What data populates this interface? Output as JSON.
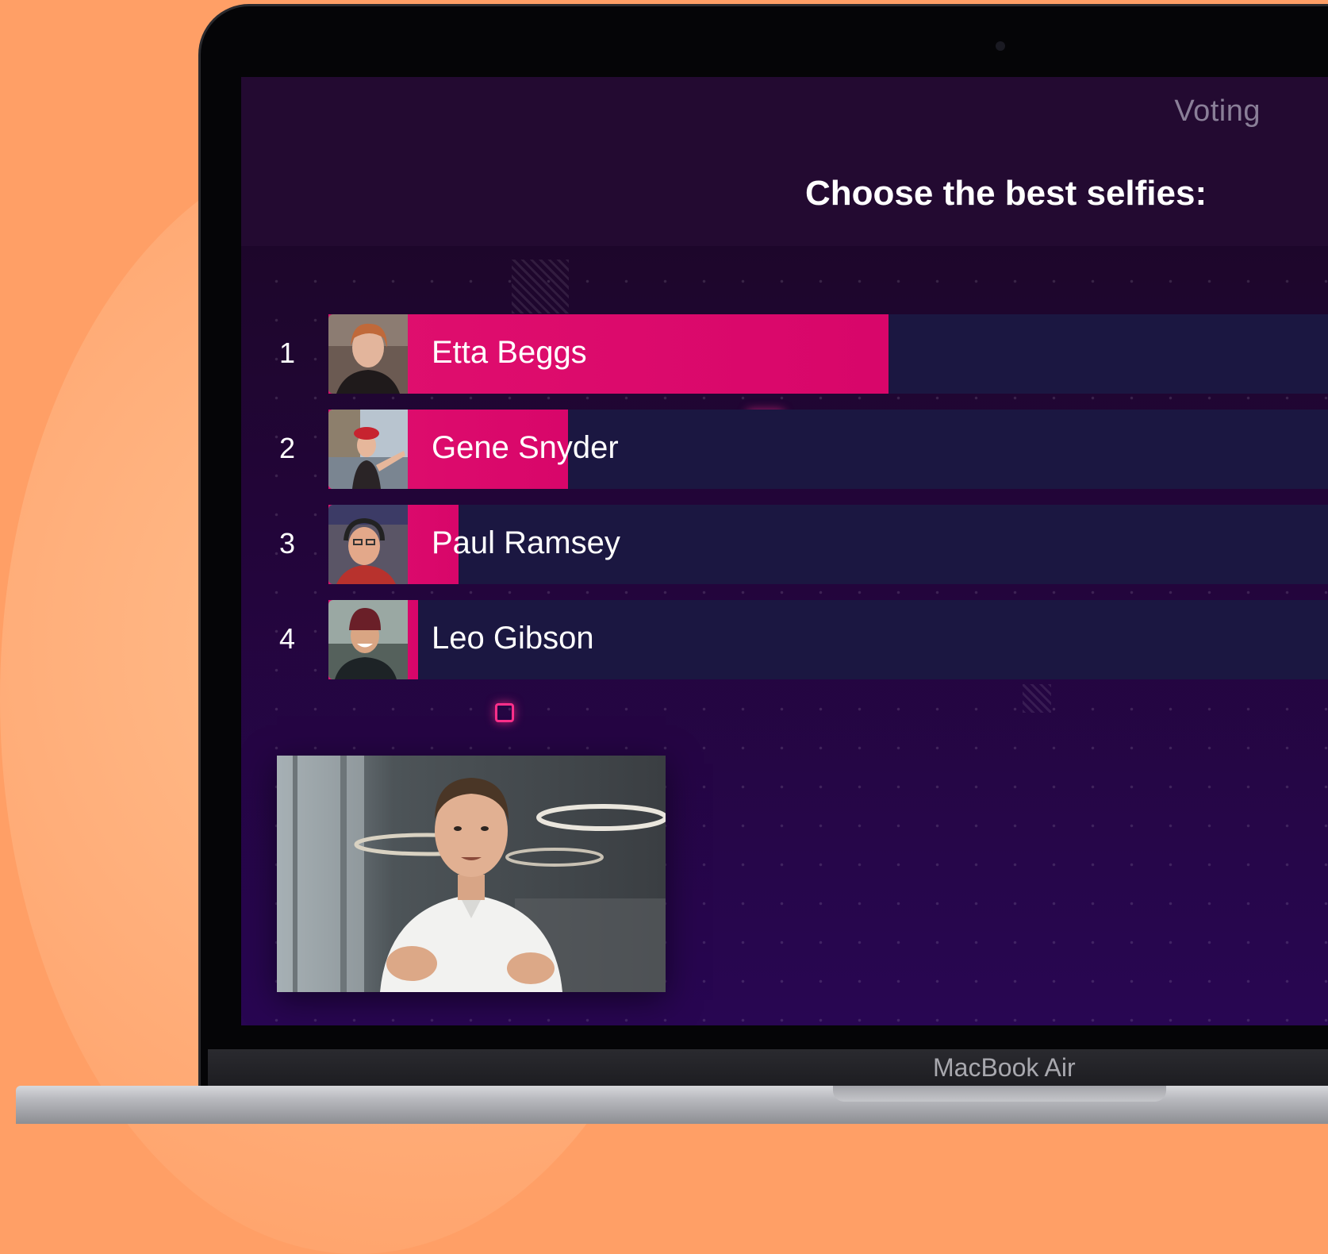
{
  "screen": {
    "title": "Voting",
    "question": "Choose the best selfies:"
  },
  "poll": {
    "accent_color": "#d8066a",
    "track_color": "#1b1741",
    "entries": [
      {
        "rank": "1",
        "name": "Etta Beggs",
        "share": 0.56
      },
      {
        "rank": "2",
        "name": "Gene Snyder",
        "share": 0.24
      },
      {
        "rank": "3",
        "name": "Paul Ramsey",
        "share": 0.13
      },
      {
        "rank": "4",
        "name": "Leo Gibson",
        "share": 0.09
      }
    ]
  },
  "device": {
    "model": "MacBook Air"
  }
}
